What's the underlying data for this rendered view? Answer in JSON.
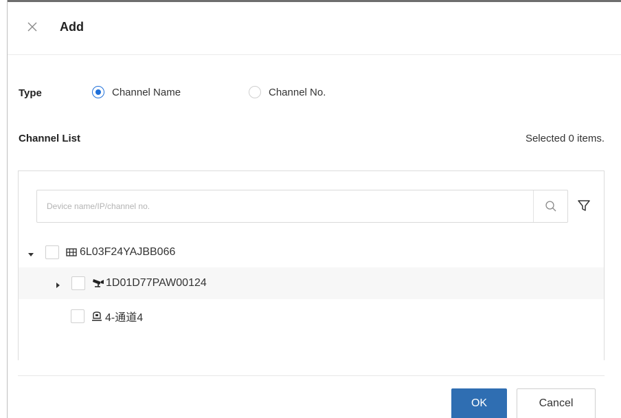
{
  "dialog": {
    "title": "Add"
  },
  "type": {
    "label": "Type",
    "options": [
      {
        "label": "Channel Name",
        "selected": true
      },
      {
        "label": "Channel No.",
        "selected": false
      }
    ]
  },
  "channel_list": {
    "label": "Channel List",
    "selected_info": "Selected 0 items."
  },
  "search": {
    "placeholder": "Device name/IP/channel no.",
    "value": ""
  },
  "tree": [
    {
      "label": "6L03F24YAJBB066",
      "icon": "nvr-device-icon",
      "expanded": true,
      "checked": false
    },
    {
      "label": "1D01D77PAW00124",
      "icon": "camera-device-icon",
      "expanded": false,
      "checked": false
    },
    {
      "label": "4-通道4",
      "icon": "channel-icon",
      "checked": false
    }
  ],
  "buttons": {
    "ok": "OK",
    "cancel": "Cancel"
  },
  "colors": {
    "accent": "#1e6fd9",
    "primary_button": "#2f6eb2"
  }
}
